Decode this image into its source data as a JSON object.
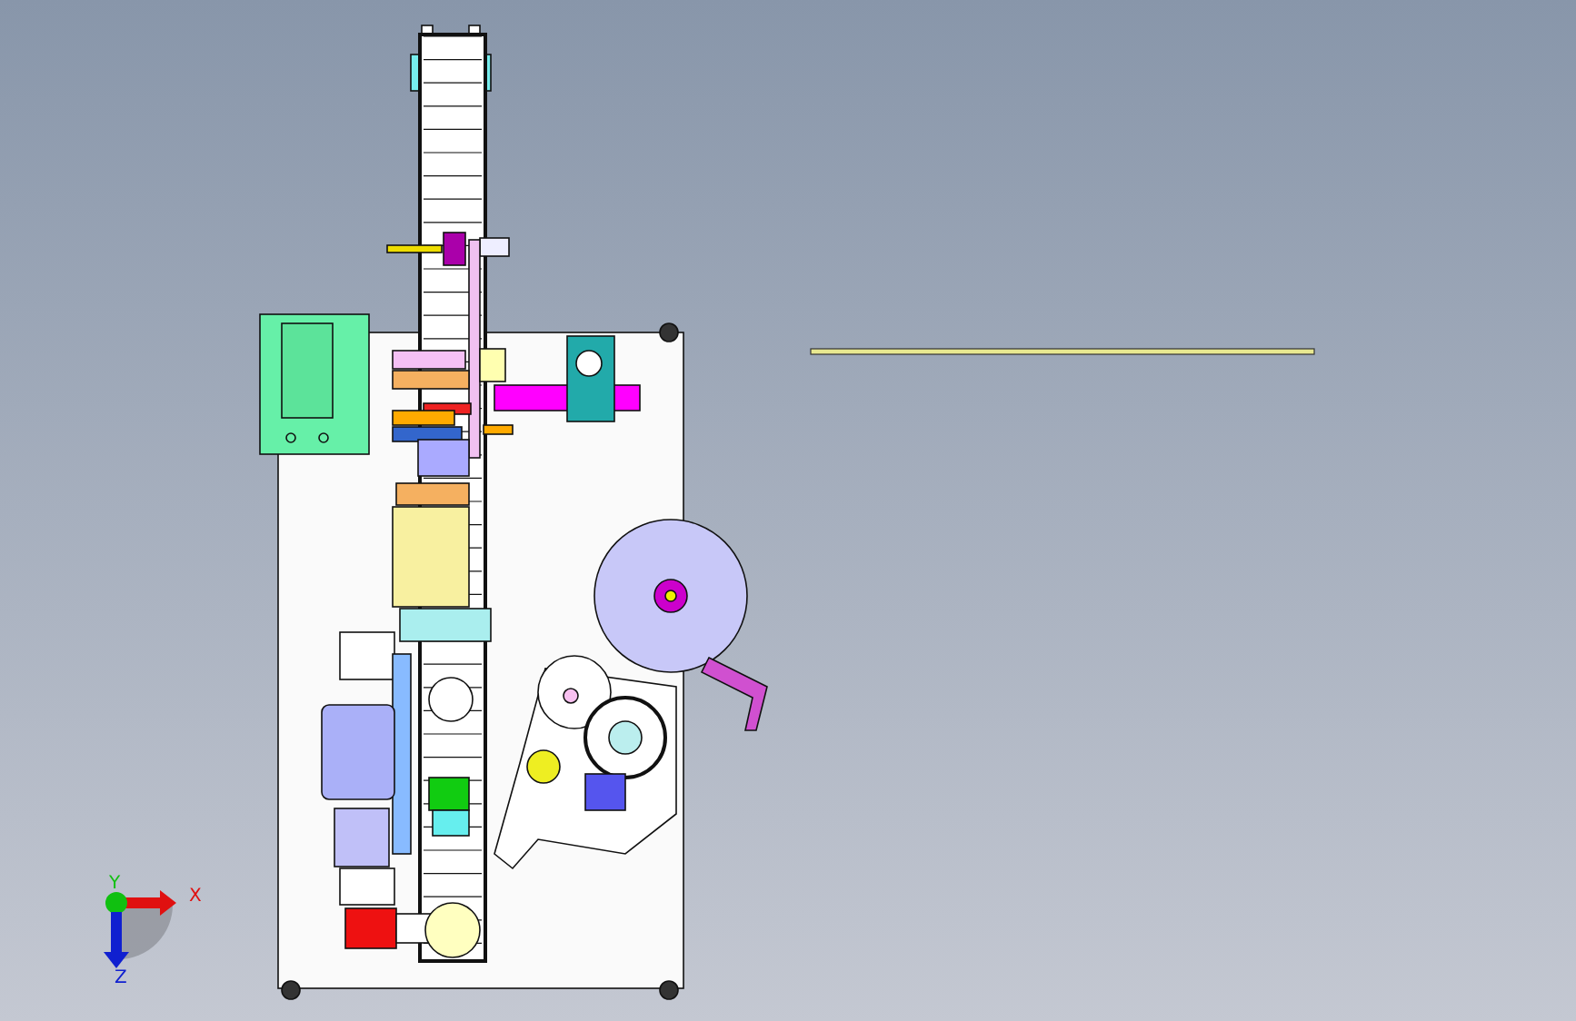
{
  "viewport": {
    "triad": {
      "axes": [
        {
          "kind": "x",
          "label": "X",
          "color": "#e01010"
        },
        {
          "kind": "y",
          "label": "Y",
          "color": "#10c010"
        },
        {
          "kind": "z",
          "label": "Z",
          "color": "#1020d0"
        }
      ]
    }
  }
}
